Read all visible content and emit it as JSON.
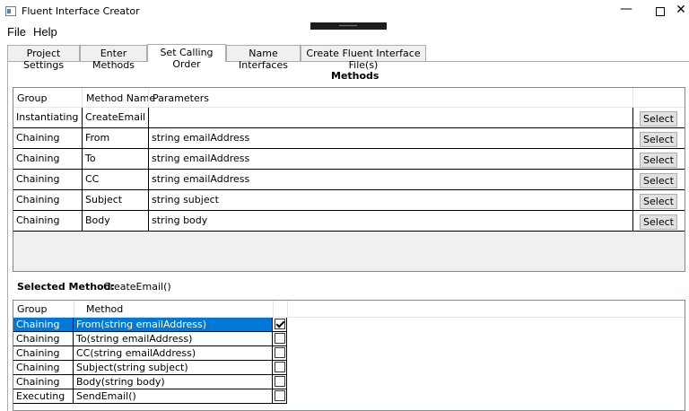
{
  "window": {
    "title": "Fluent Interface Creator",
    "minimize_glyph": "—",
    "close_glyph": "✕"
  },
  "menu": [
    {
      "label": "File"
    },
    {
      "label": "Help"
    }
  ],
  "tabs": [
    {
      "label": "Project Settings",
      "active": false
    },
    {
      "label": "Enter Methods",
      "active": false
    },
    {
      "label": "Set Calling Order",
      "active": true
    },
    {
      "label": "Name Interfaces",
      "active": false
    },
    {
      "label": "Create Fluent Interface File(s)",
      "active": false
    }
  ],
  "methods_section": {
    "title": "Methods",
    "columns": {
      "group": "Group",
      "method_name": "Method Name",
      "parameters": "Parameters"
    },
    "select_label": "Select",
    "rows": [
      {
        "group": "Instantiating",
        "method_name": "CreateEmail",
        "parameters": ""
      },
      {
        "group": "Chaining",
        "method_name": "From",
        "parameters": "string emailAddress"
      },
      {
        "group": "Chaining",
        "method_name": "To",
        "parameters": "string emailAddress"
      },
      {
        "group": "Chaining",
        "method_name": "CC",
        "parameters": "string emailAddress"
      },
      {
        "group": "Chaining",
        "method_name": "Subject",
        "parameters": "string subject"
      },
      {
        "group": "Chaining",
        "method_name": "Body",
        "parameters": "string body"
      }
    ]
  },
  "selected_method": {
    "label": "Selected Method:",
    "value": "CreateEmail()"
  },
  "calling_order": {
    "columns": {
      "group": "Group",
      "method": "Method"
    },
    "rows": [
      {
        "group": "Chaining",
        "method": "From(string emailAddress)",
        "checked": true,
        "selected": true
      },
      {
        "group": "Chaining",
        "method": "To(string emailAddress)",
        "checked": false,
        "selected": false
      },
      {
        "group": "Chaining",
        "method": "CC(string emailAddress)",
        "checked": false,
        "selected": false
      },
      {
        "group": "Chaining",
        "method": "Subject(string subject)",
        "checked": false,
        "selected": false
      },
      {
        "group": "Chaining",
        "method": "Body(string body)",
        "checked": false,
        "selected": false
      },
      {
        "group": "Executing",
        "method": "SendEmail()",
        "checked": false,
        "selected": false
      }
    ]
  }
}
